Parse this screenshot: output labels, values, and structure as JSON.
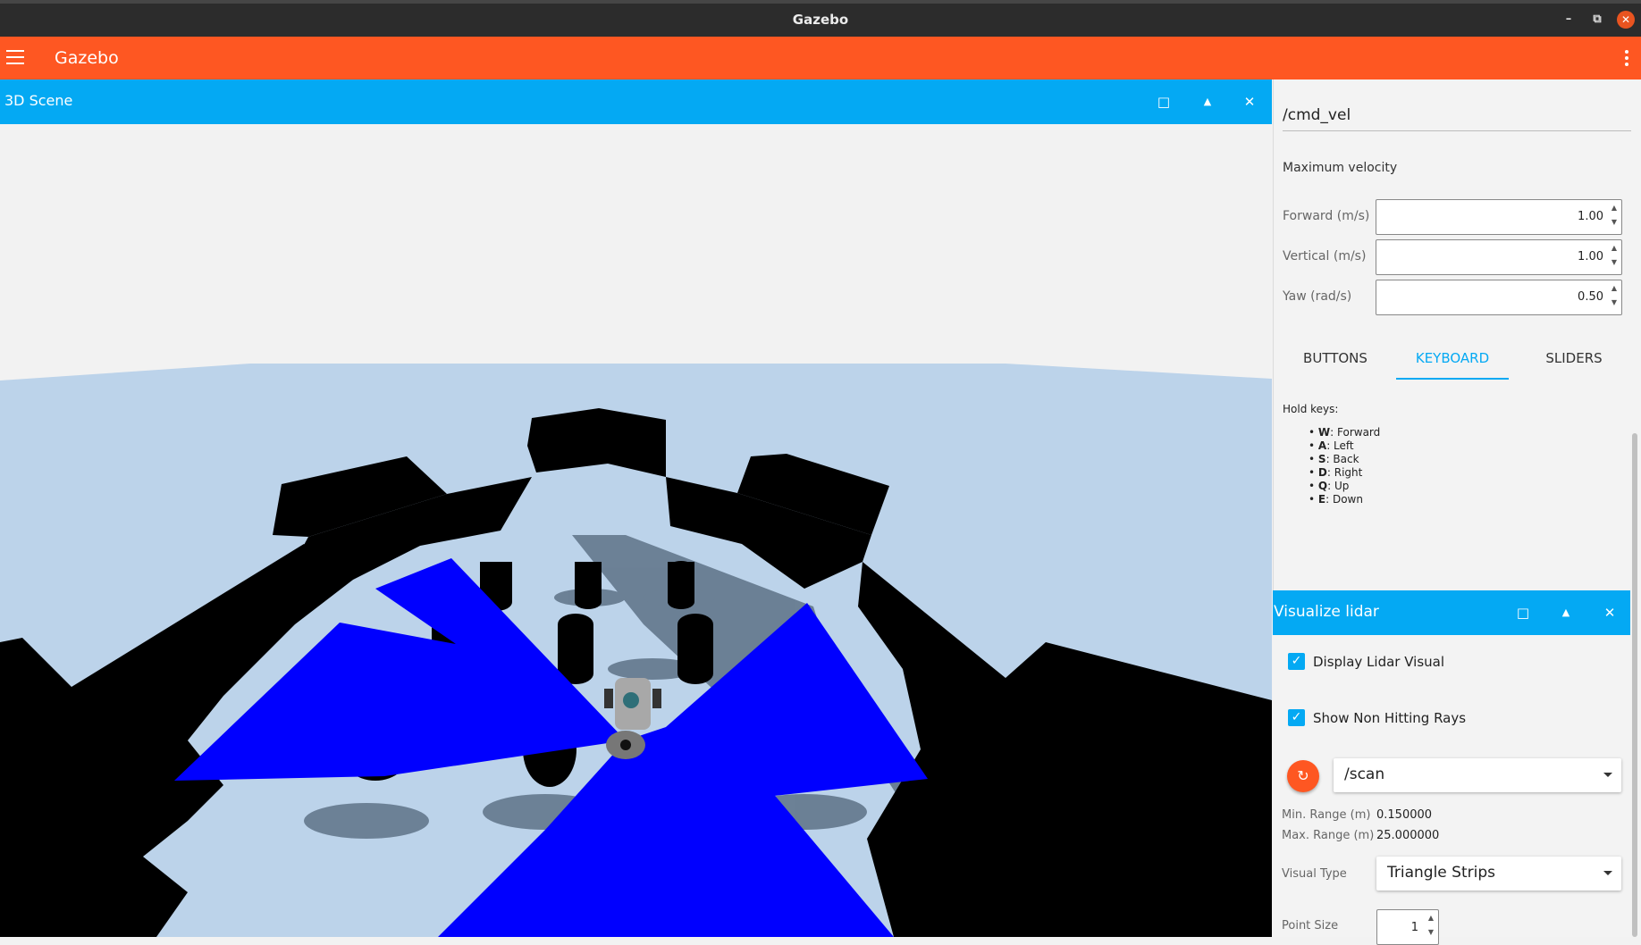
{
  "window": {
    "title": "Gazebo"
  },
  "appbar": {
    "title": "Gazebo"
  },
  "scene_panel": {
    "title": "3D Scene"
  },
  "teleop": {
    "topic": "/cmd_vel",
    "section_title": "Maximum velocity",
    "fields": [
      {
        "label": "Forward (m/s)",
        "value": "1.00"
      },
      {
        "label": "Vertical (m/s)",
        "value": "1.00"
      },
      {
        "label": "Yaw (rad/s)",
        "value": "0.50"
      }
    ],
    "tabs": [
      "BUTTONS",
      "KEYBOARD",
      "SLIDERS"
    ],
    "active_tab": "KEYBOARD",
    "hold_keys_title": "Hold keys:",
    "keys": [
      {
        "key": "W",
        "action": ": Forward"
      },
      {
        "key": "A",
        "action": ": Left"
      },
      {
        "key": "S",
        "action": ": Back"
      },
      {
        "key": "D",
        "action": ": Right"
      },
      {
        "key": "Q",
        "action": ": Up"
      },
      {
        "key": "E",
        "action": ": Down"
      }
    ]
  },
  "lidar": {
    "title": "Visualize lidar",
    "display_visual_label": "Display Lidar Visual",
    "display_visual_checked": true,
    "non_hitting_label": "Show Non Hitting Rays",
    "non_hitting_checked": true,
    "topic": "/scan",
    "min_range_label": "Min. Range (m)",
    "min_range_value": "0.150000",
    "max_range_label": "Max. Range (m)",
    "max_range_value": "25.000000",
    "visual_type_label": "Visual Type",
    "visual_type_value": "Triangle Strips",
    "point_size_label": "Point Size",
    "point_size_value": "1"
  },
  "colors": {
    "appbar": "#fe5722",
    "panel_header": "#04a9f3",
    "lidar_rays": "#0000ff",
    "floor": "#bcd3ea"
  }
}
